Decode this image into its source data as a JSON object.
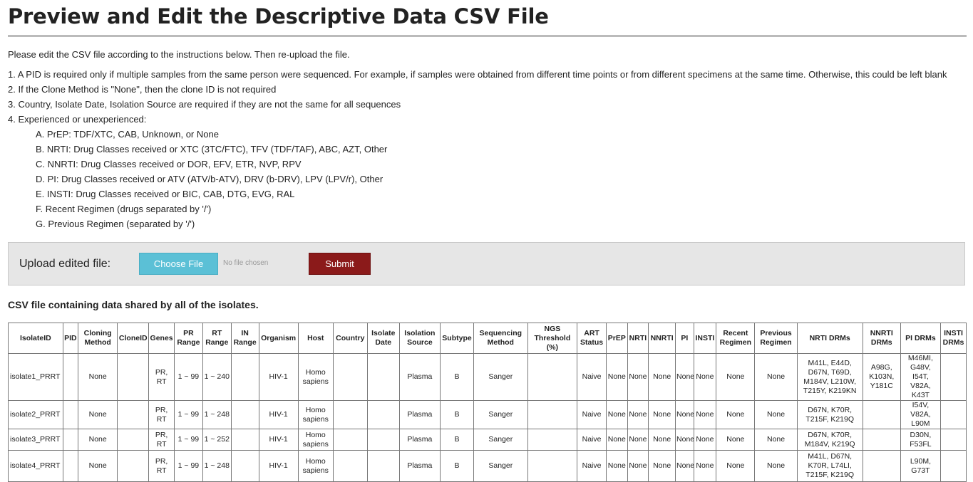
{
  "page": {
    "title": "Preview and Edit the Descriptive Data CSV File",
    "intro": "Please edit the CSV file according to the instructions below. Then re-upload the file."
  },
  "instructions": {
    "items": [
      "1. A PID is required only if multiple samples from the same person were sequenced. For example, if samples were obtained from different time points or from different specimens at the same time. Otherwise, this could be left blank",
      "2. If the Clone Method is \"None\", then the clone ID is not required",
      "3. Country, Isolate Date, Isolation Source are required if they are not the same for all sequences",
      "4. Experienced or unexperienced:"
    ],
    "subitems": [
      "A. PrEP: TDF/XTC, CAB, Unknown, or None",
      "B. NRTI: Drug Classes received or XTC (3TC/FTC), TFV (TDF/TAF), ABC, AZT, Other",
      "C. NNRTI: Drug Classes received or DOR, EFV, ETR, NVP, RPV",
      "D. PI: Drug Classes received or ATV (ATV/b-ATV), DRV (b-DRV), LPV (LPV/r), Other",
      "E. INSTI: Drug Classes received or BIC, CAB, DTG, EVG, RAL",
      "F. Recent Regimen (drugs separated by '/')",
      "G. Previous Regimen (separated by '/')"
    ]
  },
  "upload": {
    "label": "Upload edited file:",
    "choose_label": "Choose File",
    "no_file_text": "No file chosen",
    "submit_label": "Submit",
    "choose_color": "#5bc0d6",
    "submit_color": "#8b1a1a"
  },
  "csv": {
    "heading": "CSV file containing data shared by all of the isolates.",
    "columns": [
      "IsolateID",
      "PID",
      "Cloning Method",
      "CloneID",
      "Genes",
      "PR Range",
      "RT Range",
      "IN Range",
      "Organism",
      "Host",
      "Country",
      "Isolate Date",
      "Isolation Source",
      "Subtype",
      "Sequencing Method",
      "NGS Threshold (%)",
      "ART Status",
      "PrEP",
      "NRTI",
      "NNRTI",
      "PI",
      "INSTI",
      "Recent Regimen",
      "Previous Regimen",
      "NRTI DRMs",
      "NNRTI DRMs",
      "PI DRMs",
      "INSTI DRMs"
    ],
    "rows": [
      [
        "isolate1_PRRT",
        "",
        "None",
        "",
        "PR, RT",
        "1 ~ 99",
        "1 ~ 240",
        "",
        "HIV-1",
        "Homo sapiens",
        "",
        "",
        "Plasma",
        "B",
        "Sanger",
        "",
        "Naive",
        "None",
        "None",
        "None",
        "None",
        "None",
        "None",
        "None",
        "M41L, E44D, D67N, T69D, M184V, L210W, T215Y, K219KN",
        "A98G, K103N, Y181C",
        "M46MI, G48V, I54T, V82A, K43T",
        ""
      ],
      [
        "isolate2_PRRT",
        "",
        "None",
        "",
        "PR, RT",
        "1 ~ 99",
        "1 ~ 248",
        "",
        "HIV-1",
        "Homo sapiens",
        "",
        "",
        "Plasma",
        "B",
        "Sanger",
        "",
        "Naive",
        "None",
        "None",
        "None",
        "None",
        "None",
        "None",
        "None",
        "D67N, K70R, T215F, K219Q",
        "",
        "I54V, V82A, L90M",
        ""
      ],
      [
        "isolate3_PRRT",
        "",
        "None",
        "",
        "PR, RT",
        "1 ~ 99",
        "1 ~ 252",
        "",
        "HIV-1",
        "Homo sapiens",
        "",
        "",
        "Plasma",
        "B",
        "Sanger",
        "",
        "Naive",
        "None",
        "None",
        "None",
        "None",
        "None",
        "None",
        "None",
        "D67N, K70R, M184V, K219Q",
        "",
        "D30N, F53FL",
        ""
      ],
      [
        "isolate4_PRRT",
        "",
        "None",
        "",
        "PR, RT",
        "1 ~ 99",
        "1 ~ 248",
        "",
        "HIV-1",
        "Homo sapiens",
        "",
        "",
        "Plasma",
        "B",
        "Sanger",
        "",
        "Naive",
        "None",
        "None",
        "None",
        "None",
        "None",
        "None",
        "None",
        "M41L, D67N, K70R, L74LI, T215F, K219Q",
        "",
        "L90M, G73T",
        ""
      ]
    ]
  }
}
